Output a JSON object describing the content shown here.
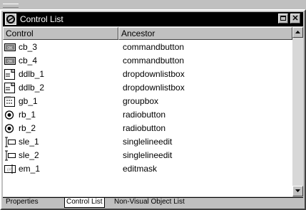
{
  "window": {
    "title": "Control List"
  },
  "columns": {
    "control": "Control",
    "ancestor": "Ancestor"
  },
  "rows": [
    {
      "name": "cb_3",
      "ancestor": "commandbutton",
      "icon": "commandbutton-icon"
    },
    {
      "name": "cb_4",
      "ancestor": "commandbutton",
      "icon": "commandbutton-icon"
    },
    {
      "name": "ddlb_1",
      "ancestor": "dropdownlistbox",
      "icon": "dropdownlistbox-icon"
    },
    {
      "name": "ddlb_2",
      "ancestor": "dropdownlistbox",
      "icon": "dropdownlistbox-icon"
    },
    {
      "name": "gb_1",
      "ancestor": "groupbox",
      "icon": "groupbox-icon"
    },
    {
      "name": "rb_1",
      "ancestor": "radiobutton",
      "icon": "radiobutton-icon"
    },
    {
      "name": "rb_2",
      "ancestor": "radiobutton",
      "icon": "radiobutton-icon"
    },
    {
      "name": "sle_1",
      "ancestor": "singlelineedit",
      "icon": "singlelineedit-icon"
    },
    {
      "name": "sle_2",
      "ancestor": "singlelineedit",
      "icon": "singlelineedit-icon"
    },
    {
      "name": "em_1",
      "ancestor": "editmask",
      "icon": "editmask-icon"
    }
  ],
  "tabs": [
    "Properties",
    "Control List",
    "Non-Visual Object List"
  ],
  "colors": {
    "titlebar": "#000000",
    "face": "#c0c0c0",
    "list_bg": "#ffffff"
  }
}
